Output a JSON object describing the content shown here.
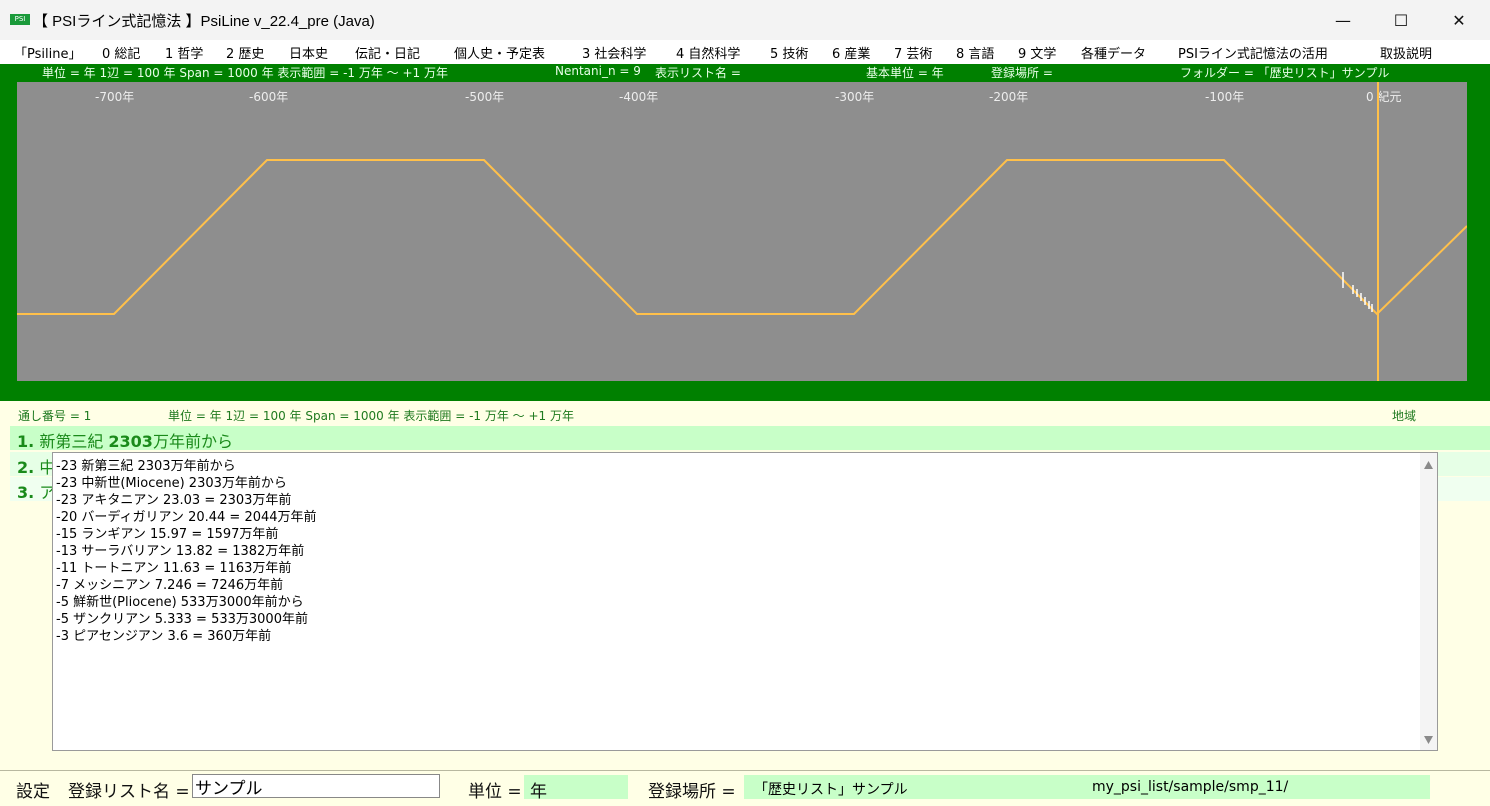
{
  "window": {
    "icon_text": "PSI",
    "title": "【 PSIライン式記憶法 】PsiLine v_22.4_pre (Java)",
    "minimize": "—",
    "maximize": "☐",
    "close": "✕"
  },
  "menu": [
    "「Psiline」",
    "0 総記",
    "1 哲学",
    "2 歴史",
    "日本史",
    "伝記・日記",
    "個人史・予定表",
    "3 社会科学",
    "4 自然科学",
    "5 技術",
    "6 産業",
    "7 芸術",
    "8 言語",
    "9 文学",
    "各種データ",
    "PSIライン式記憶法の活用",
    "取扱説明"
  ],
  "info_bar": {
    "units": "単位 = 年  1辺 = 100 年  Span = 1000 年  表示範囲 = -1 万年 ～ +1 万年",
    "nentani": "Nentani_n = 9",
    "list_name": "表示リスト名 =",
    "base_unit": "基本単位 = 年",
    "location": "登録場所 =",
    "folder": "フォルダー = 「歴史リスト」サンプル"
  },
  "timeline": {
    "ticks": [
      "-700年",
      "-600年",
      "-500年",
      "-400年",
      "-300年",
      "-200年",
      "-100年",
      "0  紀元"
    ],
    "line_color": "#ffc04a",
    "cursor_color": "#ffc04a",
    "background": "#8e8e8e"
  },
  "status_bar": {
    "serial": "通し番号 = 1",
    "units": "単位 = 年  1辺 = 100 年  Span = 1000 年  表示範囲 = -1 万年 ～ +1 万年",
    "region": "地域"
  },
  "list": [
    {
      "num": "1.",
      "text": "新第三紀 ",
      "bold": "2303",
      "rest": "万年前から"
    },
    {
      "num": "2.",
      "text": "中",
      "bold": "",
      "rest": ""
    },
    {
      "num": "3.",
      "text": "ア",
      "bold": "",
      "rest": ""
    }
  ],
  "popup_lines": [
    "-23  新第三紀 2303万年前から",
    "-23  中新世(Miocene) 2303万年前から",
    "-23  アキタニアン 23.03 = 2303万年前",
    "-20  バーディガリアン 20.44 = 2044万年前",
    "-15  ランギアン 15.97 = 1597万年前",
    "-13  サーラバリアン 13.82 = 1382万年前",
    "-11  トートニアン 11.63 = 1163万年前",
    "-7  メッシニアン 7.246 = 7246万年前",
    "-5  鮮新世(Pliocene) 533万3000年前から",
    "-5  ザンクリアン 5.333 = 533万3000年前",
    "-3  ピアセンジアン 3.6 = 360万年前"
  ],
  "footer": {
    "settings": "設定",
    "list_name_label": "登録リスト名 =",
    "list_name_value": "サンプル",
    "unit_label": "単位 =",
    "unit_value": "年",
    "location_label": "登録場所 =",
    "location_value": "「歴史リスト」サンプル",
    "path": "my_psi_list/sample/smp_11/"
  }
}
